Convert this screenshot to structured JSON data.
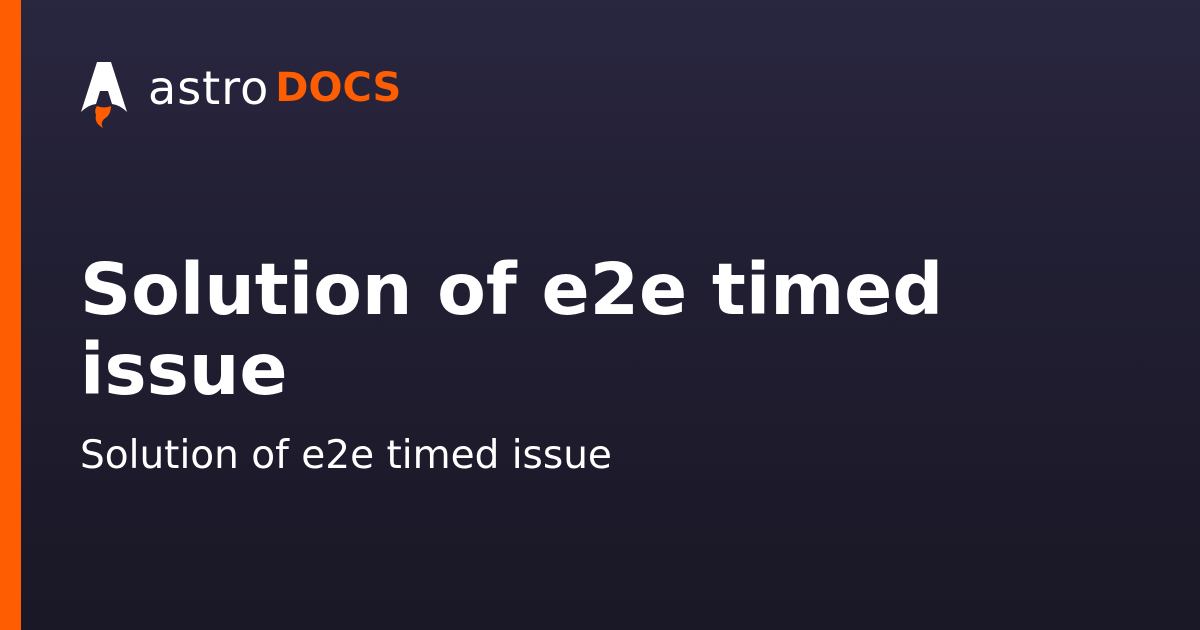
{
  "brand": {
    "wordmark_primary": "astro",
    "wordmark_secondary": "DOCS",
    "accent_color": "#ff5d01",
    "logo_icon": "astro-rocket-icon"
  },
  "page": {
    "title": "Solution of e2e timed issue",
    "description": "Solution of e2e timed issue"
  },
  "colors": {
    "background": "#23213a",
    "text": "#ffffff",
    "accent": "#ff5d01"
  }
}
